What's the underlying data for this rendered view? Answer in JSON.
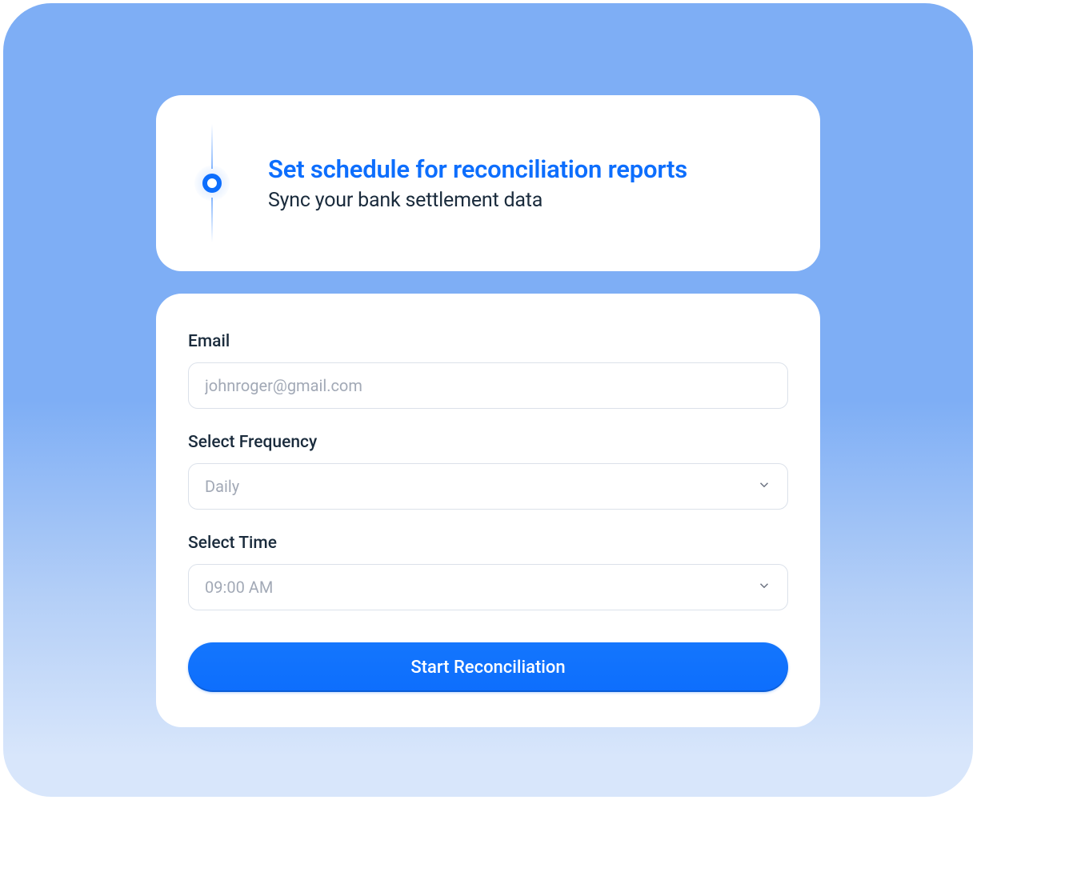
{
  "header": {
    "title": "Set schedule for reconciliation reports",
    "subtitle": "Sync your bank settlement data"
  },
  "form": {
    "email": {
      "label": "Email",
      "placeholder": "johnroger@gmail.com",
      "value": ""
    },
    "frequency": {
      "label": "Select Frequency",
      "selected": "Daily"
    },
    "time": {
      "label": "Select Time",
      "selected": "09:00 AM"
    },
    "submit_label": "Start Reconciliation"
  },
  "colors": {
    "accent": "#0d6efd",
    "background_gradient_top": "#7eaef5",
    "background_gradient_bottom": "#d8e6fb"
  }
}
